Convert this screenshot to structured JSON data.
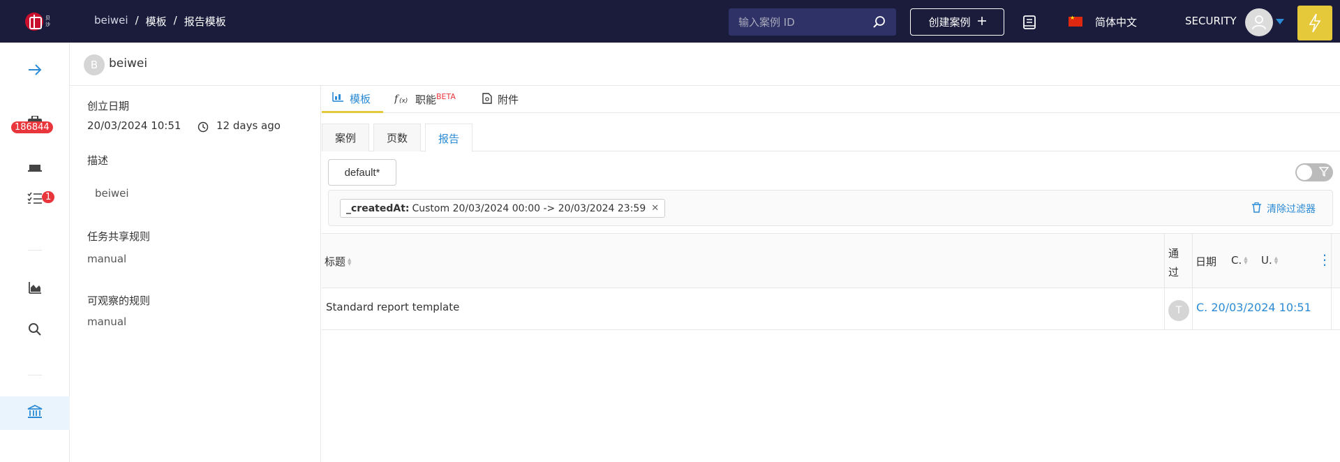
{
  "header": {
    "logo_text": "贝沙",
    "breadcrumb": [
      "beiwei",
      "模板",
      "报告模板"
    ],
    "breadcrumb_sep": "/",
    "search_placeholder": "输入案例 ID",
    "create_button": "创建案例",
    "language": "简体中文",
    "user": "SECURITY"
  },
  "sidebar": {
    "badge_count": "186844",
    "task_badge": "1"
  },
  "profile": {
    "avatar_letter": "B",
    "name": "beiwei"
  },
  "info": {
    "created_label": "创立日期",
    "created_date": "20/03/2024 10:51",
    "created_relative": "12 days ago",
    "desc_label": "描述",
    "desc_value": "beiwei",
    "share_label": "任务共享规则",
    "share_value": "manual",
    "observe_label": "可观察的规则",
    "observe_value": "manual"
  },
  "tabs": [
    {
      "label": "模板"
    },
    {
      "label": "职能",
      "sup": "BETA"
    },
    {
      "label": "附件"
    }
  ],
  "subtabs": [
    "案例",
    "页数",
    "报告"
  ],
  "filter": {
    "preset": "default*",
    "field": "_createdAt:",
    "value": "Custom 20/03/2024 00:00 -> 20/03/2024 23:59",
    "clear_label": "清除过滤器"
  },
  "table": {
    "columns": {
      "title": "标题",
      "passed_1": "通",
      "passed_2": "过",
      "date": "日期",
      "c": "C.",
      "u": "U."
    },
    "rows": [
      {
        "title": "Standard report template",
        "avatar": "T",
        "date": "C. 20/03/2024 10:51"
      }
    ]
  },
  "colors": {
    "topbar": "#1b1c3b",
    "accent": "#2b8bd6",
    "badge": "#e8363c",
    "highlight": "#e6c93a"
  }
}
